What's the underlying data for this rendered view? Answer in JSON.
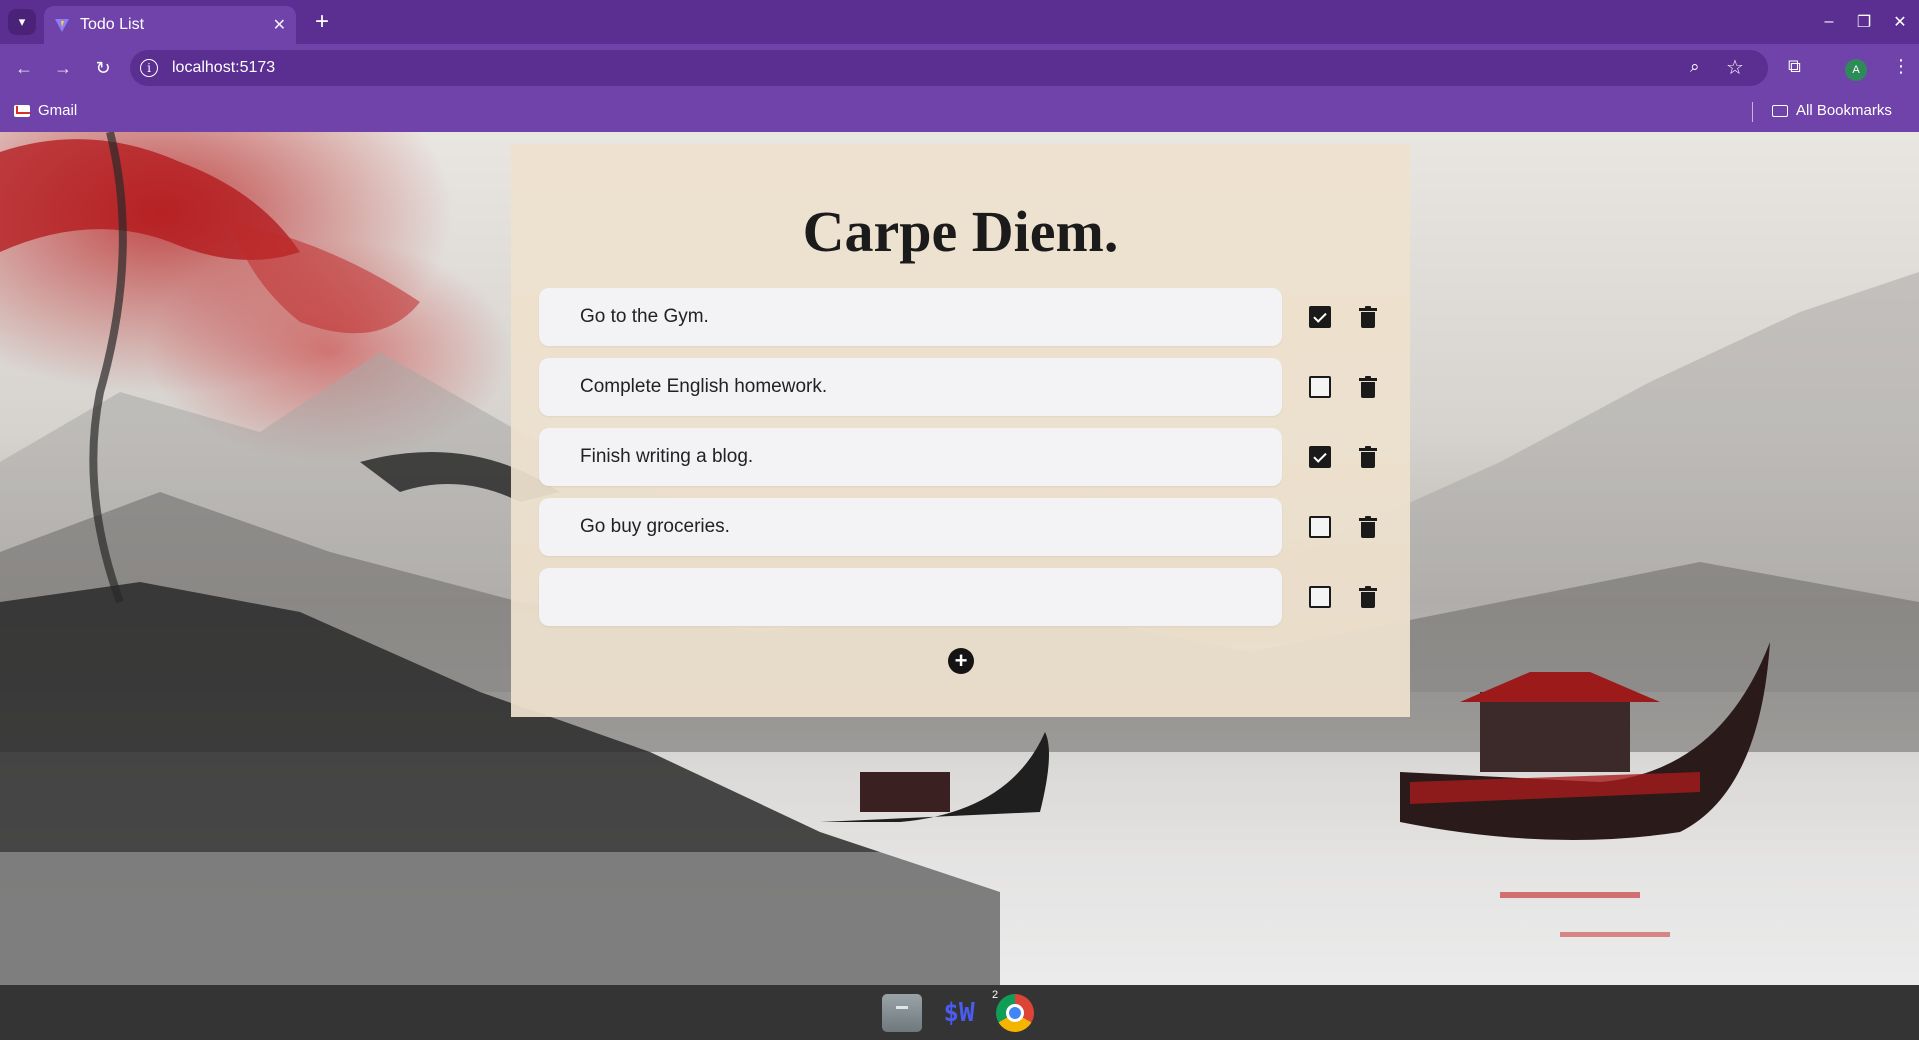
{
  "browser": {
    "tab_title": "Todo List",
    "url": "localhost:5173",
    "profile_initial": "A",
    "bookmarks": [
      {
        "label": "Gmail"
      }
    ],
    "all_bookmarks_label": "All Bookmarks"
  },
  "app": {
    "title": "Carpe Diem.",
    "todos": [
      {
        "text": "Go to the Gym.",
        "done": true
      },
      {
        "text": "Complete English homework.",
        "done": false
      },
      {
        "text": "Finish writing a blog.",
        "done": true
      },
      {
        "text": "Go buy groceries.",
        "done": false
      },
      {
        "text": "",
        "done": false
      }
    ],
    "add_icon": "plus-circle-icon",
    "delete_icon": "trash-icon"
  },
  "taskbar": {
    "apps": [
      {
        "name": "Files",
        "icon": "files-icon"
      },
      {
        "name": "$W",
        "icon": "sw-icon",
        "label": "$W"
      },
      {
        "name": "Chrome",
        "icon": "chrome-icon",
        "badge": "2"
      }
    ]
  },
  "colors": {
    "browser_frame": "#5b2e91",
    "browser_toolbar": "#7043aa",
    "card_background": "#eee1cd",
    "accent_dark": "#1a1a1a"
  }
}
